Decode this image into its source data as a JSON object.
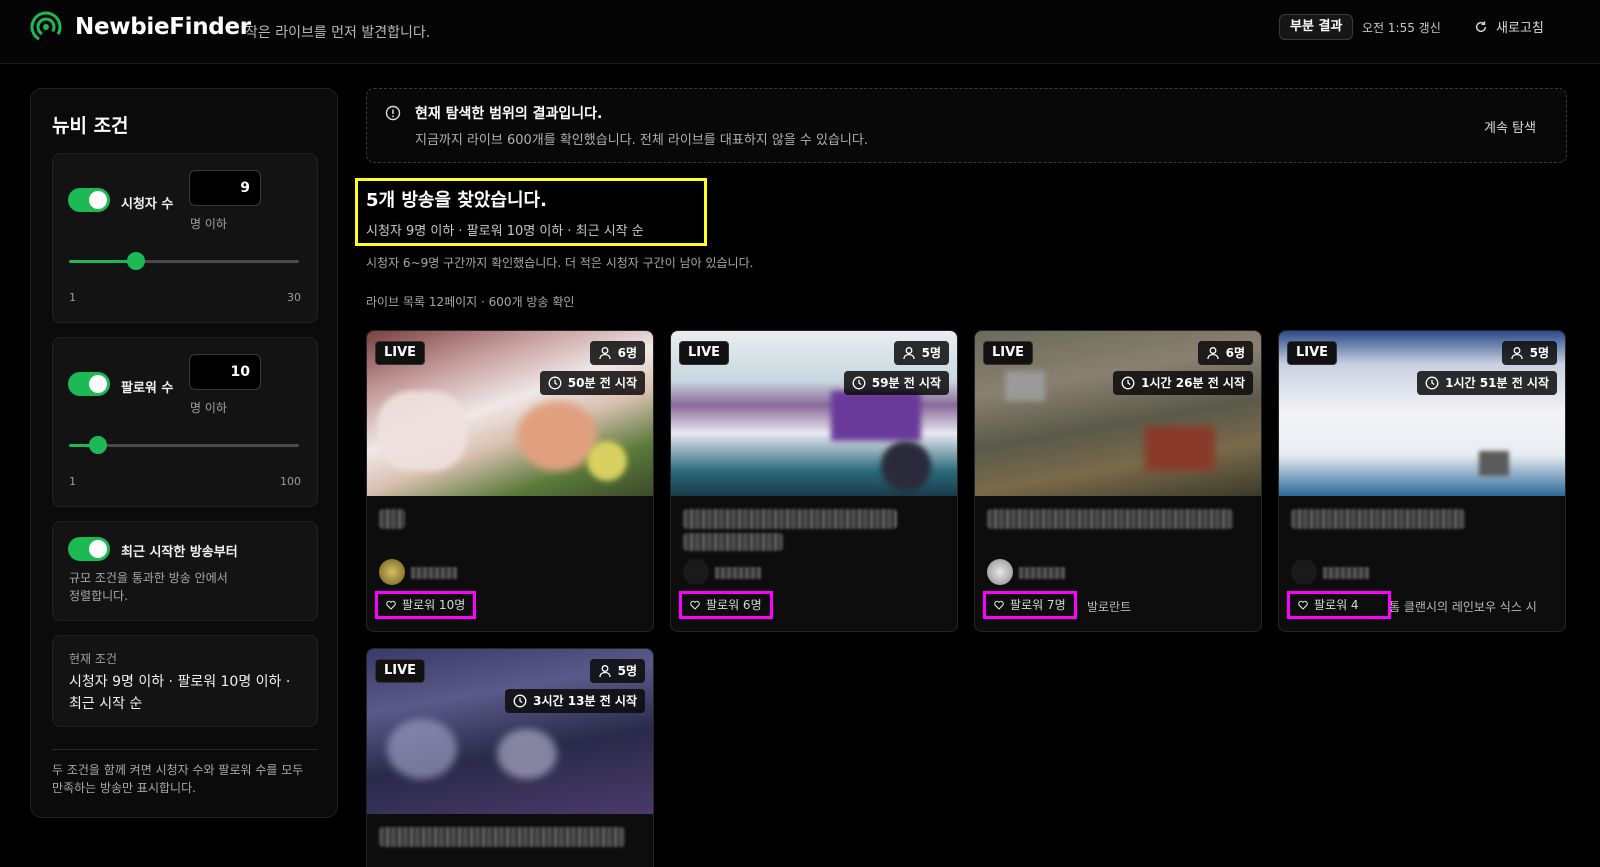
{
  "app": {
    "name": "NewbieFinder",
    "tagline": "작은 라이브를 먼저 발견합니다.",
    "partial_badge": "부분 결과",
    "updated": "오전 1:55 갱신",
    "refresh_label": "새로고침",
    "accent_color": "#1db954"
  },
  "sidebar": {
    "title": "뉴비 조건",
    "viewers": {
      "label": "시청자 수",
      "value": "9",
      "unit": "명 이하",
      "min": "1",
      "max": "30",
      "level": 9,
      "enabled": true
    },
    "followers": {
      "label": "팔로워 수",
      "value": "10",
      "unit": "명 이하",
      "min": "1",
      "max": "100",
      "level": 10,
      "enabled": true
    },
    "recent": {
      "label": "최근 시작한 방송부터",
      "desc_line1": "규모 조건을 통과한 방송 안에서",
      "desc_line2": "정렬합니다.",
      "enabled": true
    },
    "current": {
      "title": "현재 조건",
      "text": "시청자 9명 이하 · 팔로워 10명 이하 · 최근 시작 순"
    },
    "footnote": "두 조건을 함께 켜면 시청자 수와 팔로워 수를 모두 만족하는 방송만 표시합니다."
  },
  "notice": {
    "title": "현재 탐색한 범위의 결과입니다.",
    "desc": "지금까지 라이브 600개를 확인했습니다. 전체 라이브를 대표하지 않을 수 있습니다.",
    "button": "계속 탐색"
  },
  "results": {
    "title": "5개 방송을 찾았습니다.",
    "subtitle": "시청자 9명 이하 · 팔로워 10명 이하 · 최근 시작 순",
    "note": "시청자 6~9명 구간까지 확인했습니다. 더 적은 시청자 구간이 남아 있습니다.",
    "pages": "라이브 목록 12페이지 · 600개 방송 확인"
  },
  "cards": [
    {
      "live": "LIVE",
      "viewers": "6명",
      "started": "50분 전 시작",
      "followers": "팔로워 10명",
      "category": ""
    },
    {
      "live": "LIVE",
      "viewers": "5명",
      "started": "59분 전 시작",
      "followers": "팔로워 6명",
      "category": ""
    },
    {
      "live": "LIVE",
      "viewers": "6명",
      "started": "1시간 26분 전 시작",
      "followers": "팔로워 7명",
      "category": "발로란트"
    },
    {
      "live": "LIVE",
      "viewers": "5명",
      "started": "1시간 51분 전 시작",
      "followers": "팔로워 4",
      "category": "톰 클랜시의 레인보우 식스 시"
    },
    {
      "live": "LIVE",
      "viewers": "5명",
      "started": "3시간 13분 전 시작",
      "followers": "",
      "category": ""
    }
  ]
}
